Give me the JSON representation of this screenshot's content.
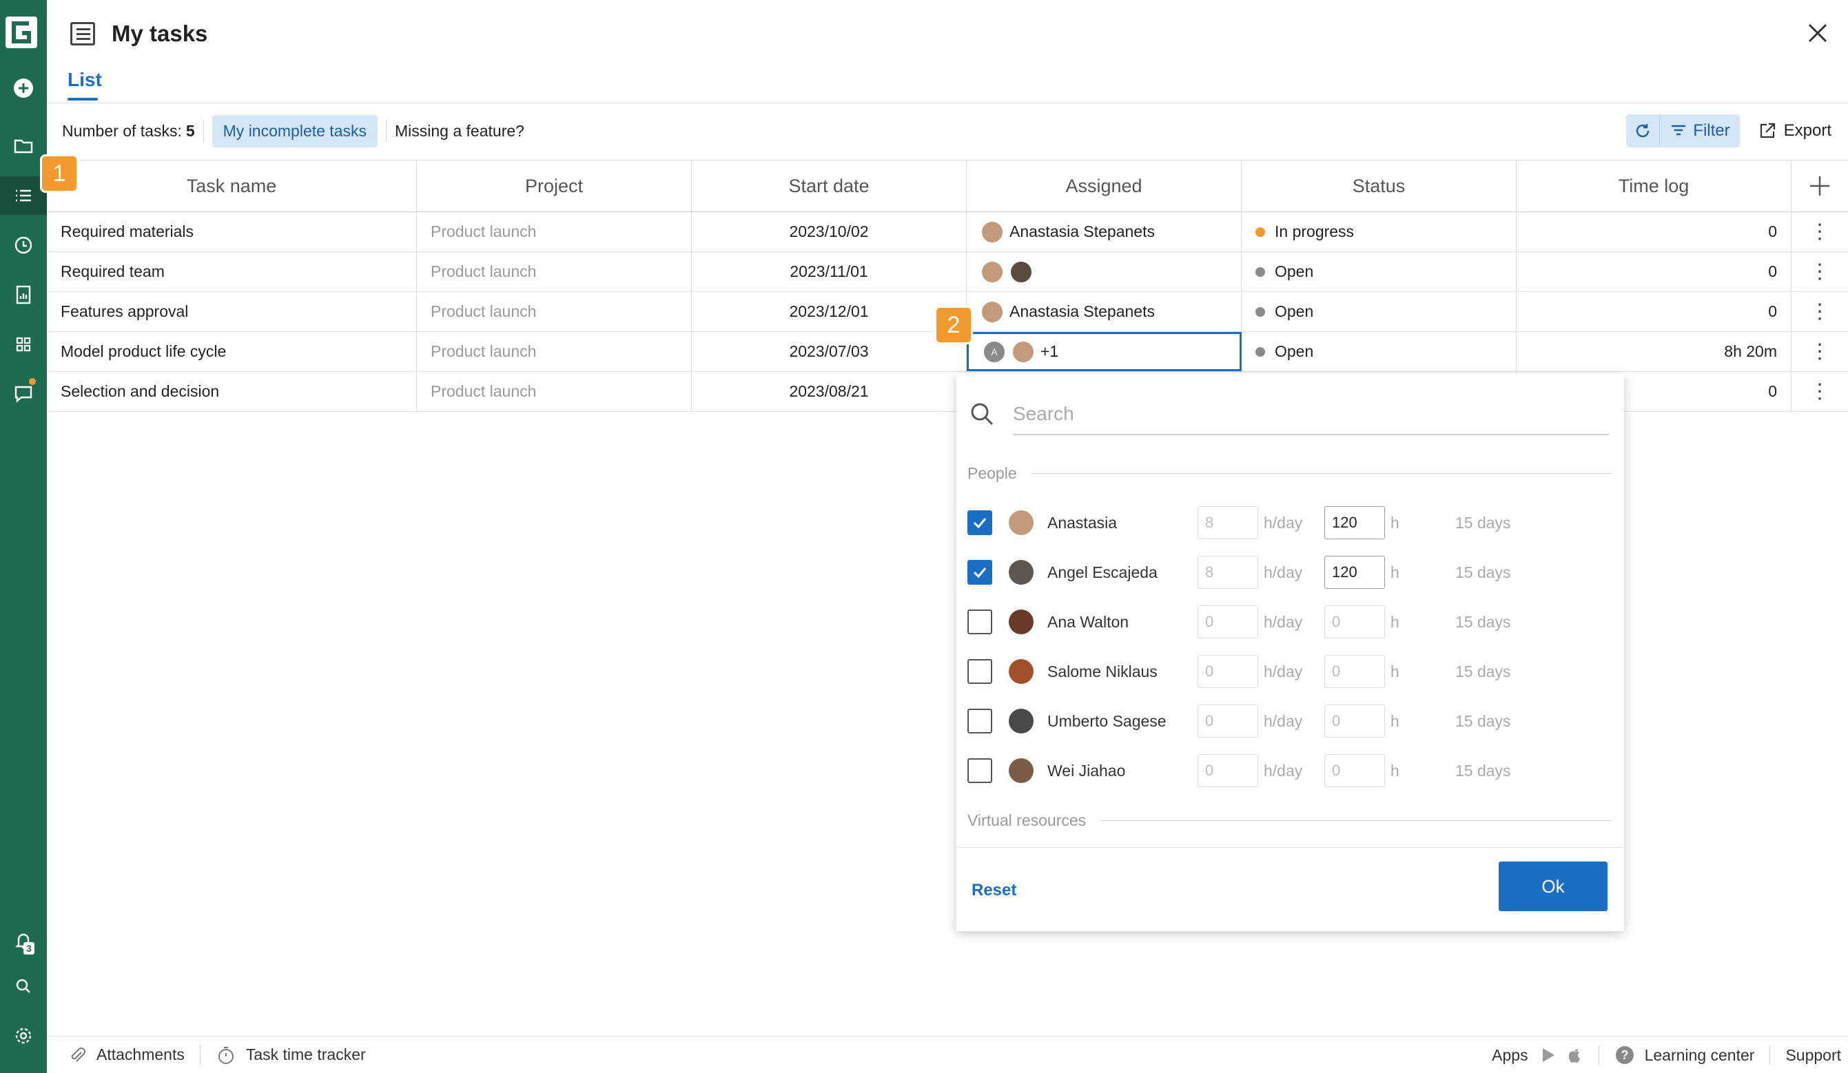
{
  "header": {
    "title": "My tasks",
    "tab": "List"
  },
  "toolbar": {
    "count_label": "Number of tasks:",
    "count_value": "5",
    "chip": "My incomplete tasks",
    "missing": "Missing a feature?",
    "filter": "Filter",
    "export": "Export"
  },
  "callouts": {
    "one": "1",
    "two": "2"
  },
  "rail": {
    "notifications_count": "3"
  },
  "table": {
    "columns": [
      "Task name",
      "Project",
      "Start date",
      "Assigned",
      "Status",
      "Time log"
    ],
    "rows": [
      {
        "task": "Required materials",
        "project": "Product launch",
        "start": "2023/10/02",
        "assigned": "Anastasia Stepanets",
        "status": "In progress",
        "timelog": "0"
      },
      {
        "task": "Required team",
        "project": "Product launch",
        "start": "2023/11/01",
        "assigned": "",
        "status": "Open",
        "timelog": "0"
      },
      {
        "task": "Features approval",
        "project": "Product launch",
        "start": "2023/12/01",
        "assigned": "Anastasia Stepanets",
        "status": "Open",
        "timelog": "0"
      },
      {
        "task": "Model product life cycle",
        "project": "Product launch",
        "start": "2023/07/03",
        "assigned": "+1",
        "assigned_avatar_letter": "A",
        "status": "Open",
        "timelog": "8h 20m"
      },
      {
        "task": "Selection and decision",
        "project": "Product launch",
        "start": "2023/08/21",
        "assigned": "",
        "status": "",
        "timelog": "0"
      }
    ]
  },
  "dropdown": {
    "search_placeholder": "Search",
    "people_label": "People",
    "virtual_label": "Virtual resources",
    "unit_day": "h/day",
    "unit_h": "h",
    "people": [
      {
        "name": "Anastasia",
        "checked": true,
        "perday": "8",
        "hours": "120",
        "days": "15 days"
      },
      {
        "name": "Angel Escajeda",
        "checked": true,
        "perday": "8",
        "hours": "120",
        "days": "15 days"
      },
      {
        "name": "Ana Walton",
        "checked": false,
        "perday": "0",
        "hours": "0",
        "days": "15 days"
      },
      {
        "name": "Salome Niklaus",
        "checked": false,
        "perday": "0",
        "hours": "0",
        "days": "15 days"
      },
      {
        "name": "Umberto Sagese",
        "checked": false,
        "perday": "0",
        "hours": "0",
        "days": "15 days"
      },
      {
        "name": "Wei Jiahao",
        "checked": false,
        "perday": "0",
        "hours": "0",
        "days": "15 days"
      }
    ],
    "reset": "Reset",
    "ok": "Ok"
  },
  "footer": {
    "attachments": "Attachments",
    "tracker": "Task time tracker",
    "apps": "Apps",
    "learning": "Learning center",
    "support": "Support"
  },
  "colors": {
    "rail": "#1f6b4f",
    "accent": "#1a6fc4",
    "callout": "#f29a2e",
    "in_progress": "#f29a2e",
    "open": "#8a8a8a"
  }
}
